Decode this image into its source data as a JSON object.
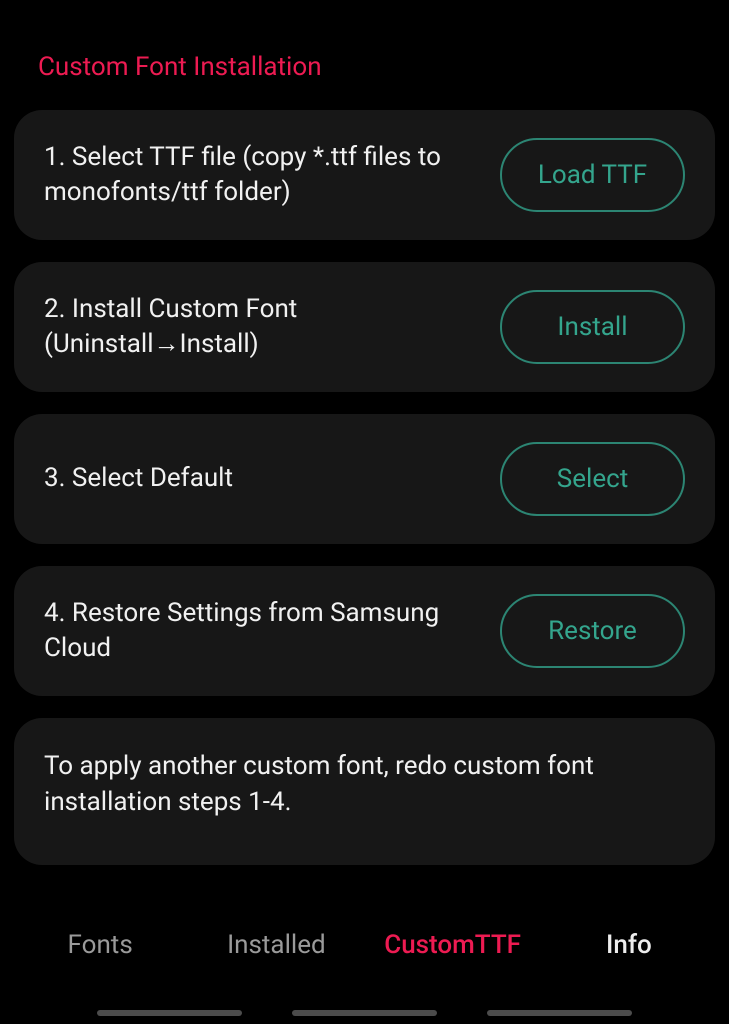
{
  "section_title": "Custom Font Installation",
  "steps": [
    {
      "text": "1. Select TTF file (copy *.ttf files to monofonts/ttf folder)",
      "button": "Load TTF"
    },
    {
      "text": "2. Install Custom Font (Uninstall→Install)",
      "button": "Install"
    },
    {
      "text": "3. Select Default",
      "button": "Select"
    },
    {
      "text": "4. Restore Settings from Samsung Cloud",
      "button": "Restore"
    }
  ],
  "note": "To apply another custom font, redo custom font installation steps 1-4.",
  "tabs": {
    "fonts": "Fonts",
    "installed": "Installed",
    "customttf": "CustomTTF",
    "info": "Info"
  }
}
